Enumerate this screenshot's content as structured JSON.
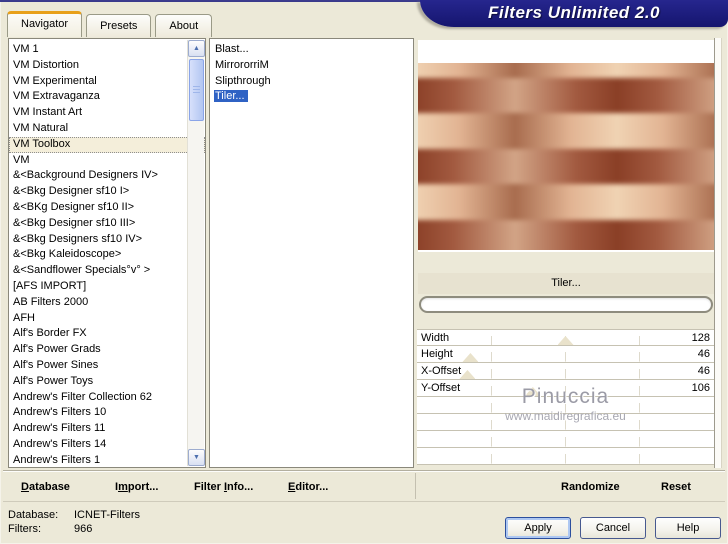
{
  "window": {
    "title": "Filters Unlimited 2.0"
  },
  "tabs": [
    {
      "label": "Navigator",
      "active": true
    },
    {
      "label": "Presets",
      "active": false
    },
    {
      "label": "About",
      "active": false
    }
  ],
  "categories": {
    "selected": "VM Toolbox",
    "items": [
      "VM 1",
      "VM Distortion",
      "VM Experimental",
      "VM Extravaganza",
      "VM Instant Art",
      "VM Natural",
      "VM Toolbox",
      "VM",
      "&<Background Designers IV>",
      "&<Bkg Designer sf10 I>",
      "&<BKg Designer sf10 II>",
      "&<Bkg Designer sf10 III>",
      "&<Bkg Designers sf10 IV>",
      "&<Bkg Kaleidoscope>",
      "&<Sandflower Specials°v° >",
      "[AFS IMPORT]",
      "AB Filters 2000",
      "AFH",
      "Alf's Border FX",
      "Alf's Power Grads",
      "Alf's Power Sines",
      "Alf's Power Toys",
      "Andrew's Filter Collection 62",
      "Andrew's Filters 10",
      "Andrew's Filters 11",
      "Andrew's Filters 14",
      "Andrew's Filters 1"
    ]
  },
  "filters": {
    "selected": "Tiler...",
    "items": [
      "Blast...",
      "MirrororriM",
      "Slipthrough",
      "Tiler..."
    ]
  },
  "preview": {
    "panel_title": "Tiler...",
    "watermark": {
      "line1": "Pinuccia",
      "line2": "www.maidiregrafica.eu"
    }
  },
  "parameters": [
    {
      "label": "Width",
      "value": 128,
      "percent": 50
    },
    {
      "label": "Height",
      "value": 46,
      "percent": 18
    },
    {
      "label": "X-Offset",
      "value": 46,
      "percent": 17
    },
    {
      "label": "Y-Offset",
      "value": 106,
      "percent": 39
    }
  ],
  "toolbar": {
    "database": {
      "pre": "",
      "accel": "D",
      "post": "atabase"
    },
    "import": {
      "pre": "I",
      "accel": "m",
      "post": "port..."
    },
    "filter_info": {
      "pre": "Filter ",
      "accel": "I",
      "post": "nfo..."
    },
    "editor": {
      "pre": "",
      "accel": "E",
      "post": "ditor..."
    },
    "randomize": "Randomize",
    "reset": "Reset"
  },
  "status": {
    "database_label": "Database:",
    "database_value": "ICNET-Filters",
    "filters_label": "Filters:",
    "filters_value": "966"
  },
  "action_buttons": [
    {
      "label": "Apply",
      "focused": true
    },
    {
      "label": "Cancel",
      "focused": false
    },
    {
      "label": "Help",
      "focused": false
    }
  ],
  "icons": {
    "scroll_up": "▲",
    "scroll_down": "▼"
  },
  "colors": {
    "dialog_bg": "#ece9d8",
    "accent_navy": "#1b1b7e",
    "tab_active_top": "#e8a01a",
    "selection_blue": "#2f62c4",
    "pattern_light": "#f0d3b3",
    "pattern_mid_light": "#e2b493",
    "pattern_dark": "#8a3f26",
    "pattern_mid_dark": "#d2a486",
    "watermark_gray": "#9b9ba6"
  }
}
